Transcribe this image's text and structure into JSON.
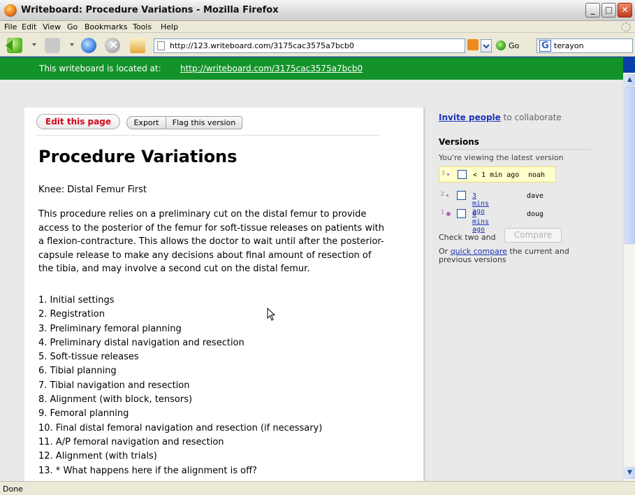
{
  "window": {
    "title": "Writeboard: Procedure Variations - Mozilla Firefox",
    "min_label": "_",
    "max_label": "□",
    "close_label": "✕"
  },
  "menu": [
    "File",
    "Edit",
    "View",
    "Go",
    "Bookmarks",
    "Tools",
    "Help"
  ],
  "navbar": {
    "url": "http://123.writeboard.com/3175cac3575a7bcb0",
    "go_label": "Go",
    "search_engine_icon": "G",
    "search_value": "terayon"
  },
  "banner": {
    "label": "This writeboard is located at:",
    "link": "http://writeboard.com/3175cac3575a7bcb0",
    "color": "#14932a"
  },
  "toolbar": {
    "edit_label": "Edit this page",
    "export_label": "Export",
    "flag_label": "Flag this version"
  },
  "document": {
    "title": "Procedure Variations",
    "subtitle": "Knee: Distal Femur First",
    "paragraph": "This procedure relies on a preliminary cut on the distal femur to provide access to the posterior of the femur for soft-tissue releases on patients with a flexion-contracture. This allows the doctor to wait until after the posterior-capsule release to make any decisions about final amount of resection of the tibia, and may involve a second cut on the distal femur.",
    "steps": [
      "1. Initial settings",
      "2. Registration",
      "3. Preliminary femoral planning",
      "4. Preliminary distal navigation and resection",
      "5. Soft-tissue releases",
      "6. Tibial planning",
      "7. Tibial navigation and resection",
      "8. Alignment (with block, tensors)",
      "9. Femoral planning",
      "10. Final distal femoral navigation and resection (if necessary)",
      "11. A/P femoral navigation and resection",
      "12. Alignment (with trials)",
      "13. * What happens here if the alignment is off?"
    ]
  },
  "sidebar": {
    "invite_link": "Invite people",
    "invite_rest": "to collaborate",
    "versions_heading": "Versions",
    "versions_note": "You're viewing the latest version",
    "versions": [
      {
        "number": "3",
        "time": "< 1 min ago",
        "author": "noah",
        "current": true
      },
      {
        "number": "2",
        "time": "3 mins ago",
        "author": "dave",
        "current": false
      },
      {
        "number": "1",
        "time": "9 mins ago",
        "author": "doug",
        "current": false
      }
    ],
    "check_two": "Check two and",
    "compare_label": "Compare",
    "or_prefix": "Or",
    "quick_compare": "quick compare",
    "or_suffix": "the current and previous versions"
  },
  "status": {
    "text": "Done"
  }
}
